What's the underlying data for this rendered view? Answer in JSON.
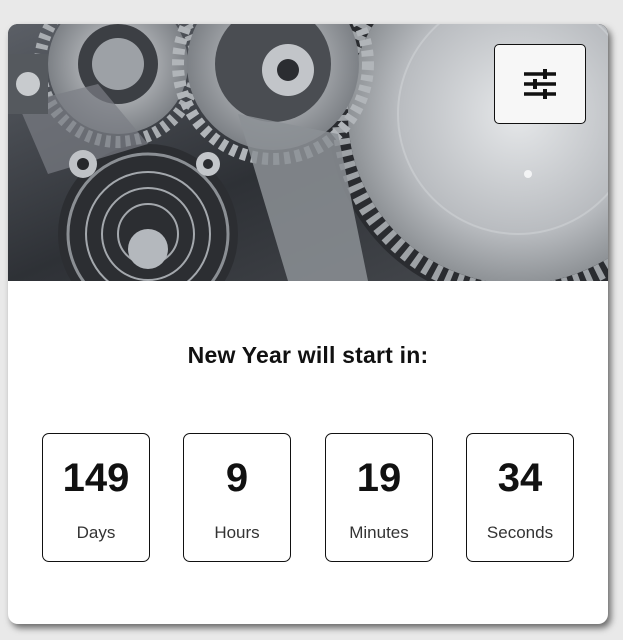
{
  "header": {
    "image_icon": "clockwork-gears-image",
    "settings_icon": "sliders-icon"
  },
  "countdown": {
    "title": "New Year will start in:",
    "units": [
      {
        "value": "149",
        "label": "Days"
      },
      {
        "value": "9",
        "label": "Hours"
      },
      {
        "value": "19",
        "label": "Minutes"
      },
      {
        "value": "34",
        "label": "Seconds"
      }
    ]
  }
}
